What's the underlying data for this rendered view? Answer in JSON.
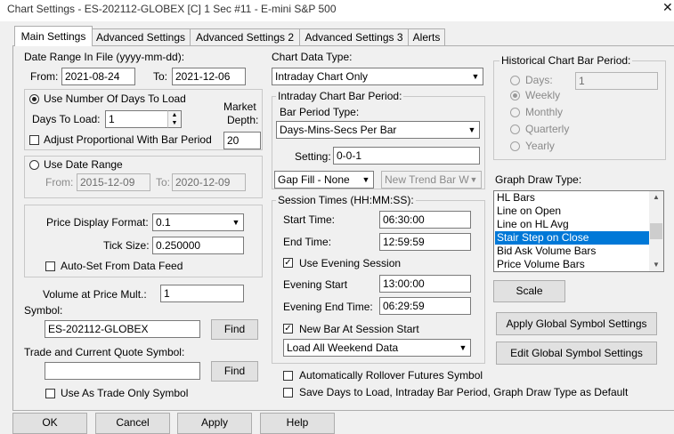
{
  "window": {
    "title": "Chart Settings - ES-202112-GLOBEX [C]  1 Sec   #11 - E-mini S&P 500",
    "close_icon": "close-icon"
  },
  "tabs": [
    "Main Settings",
    "Advanced Settings",
    "Advanced Settings 2",
    "Advanced Settings 3",
    "Alerts"
  ],
  "date_range": {
    "label": "Date Range In File (yyyy-mm-dd):",
    "from_label": "From:",
    "from_value": "2021-08-24",
    "to_label": "To:",
    "to_value": "2021-12-06"
  },
  "days_group": {
    "radio_label": "Use Number Of Days To Load",
    "days_label": "Days To Load:",
    "days_value": "1",
    "market_depth_label_1": "Market",
    "market_depth_label_2": "Depth:",
    "market_depth_value": "20",
    "adjust_label": "Adjust Proportional With Bar Period"
  },
  "date_range_group": {
    "radio_label": "Use Date Range",
    "from_label": "From:",
    "from_value": "2015-12-09",
    "to_label": "To:",
    "to_value": "2020-12-09"
  },
  "price_group": {
    "format_label": "Price Display Format:",
    "format_value": "0.1",
    "tick_label": "Tick Size:",
    "tick_value": "0.250000",
    "autoset_label": "Auto-Set From Data Feed"
  },
  "volume": {
    "label": "Volume at Price Mult.:",
    "value": "1"
  },
  "symbol": {
    "label": "Symbol:",
    "value": "ES-202112-GLOBEX",
    "find": "Find"
  },
  "trade_symbol": {
    "label": "Trade and Current Quote Symbol:",
    "value": "",
    "find": "Find",
    "trade_only_label": "Use As Trade Only Symbol"
  },
  "chart_data_type": {
    "label": "Chart Data Type:",
    "value": "Intraday Chart Only"
  },
  "intraday_bar": {
    "group_label": "Intraday Chart Bar Period:",
    "period_type_label": "Bar Period Type:",
    "period_type_value": "Days-Mins-Secs Per Bar",
    "setting_label": "Setting:",
    "setting_value": "0-0-1",
    "gap_fill_value": "Gap Fill - None",
    "new_trend_value": "New Trend Bar W"
  },
  "session": {
    "group_label": "Session Times (HH:MM:SS):",
    "start_label": "Start Time:",
    "start_value": "06:30:00",
    "end_label": "End Time:",
    "end_value": "12:59:59",
    "evening_label": "Use Evening Session",
    "evening_start_label": "Evening Start",
    "evening_start_value": "13:00:00",
    "evening_end_label": "Evening End Time:",
    "evening_end_value": "06:29:59",
    "new_bar_label": "New Bar At Session Start",
    "weekend_value": "Load All Weekend Data"
  },
  "historical": {
    "group_label": "Historical Chart Bar Period:",
    "days_label": "Days:",
    "days_value": "1",
    "weekly": "Weekly",
    "monthly": "Monthly",
    "quarterly": "Quarterly",
    "yearly": "Yearly"
  },
  "graph_draw": {
    "label": "Graph Draw Type:",
    "items": [
      "HL Bars",
      "Line on Open",
      "Line on HL Avg",
      "Stair Step on Close",
      "Bid Ask Volume Bars",
      "Price Volume Bars"
    ],
    "selected": "Stair Step on Close"
  },
  "right_buttons": {
    "scale": "Scale",
    "apply_global": "Apply Global Symbol Settings",
    "edit_global": "Edit Global Symbol Settings"
  },
  "bottom_checks": {
    "rollover": "Automatically Rollover Futures Symbol",
    "save_default": "Save Days to Load, Intraday Bar Period, Graph Draw Type as Default"
  },
  "footer": {
    "ok": "OK",
    "cancel": "Cancel",
    "apply": "Apply",
    "help": "Help"
  }
}
